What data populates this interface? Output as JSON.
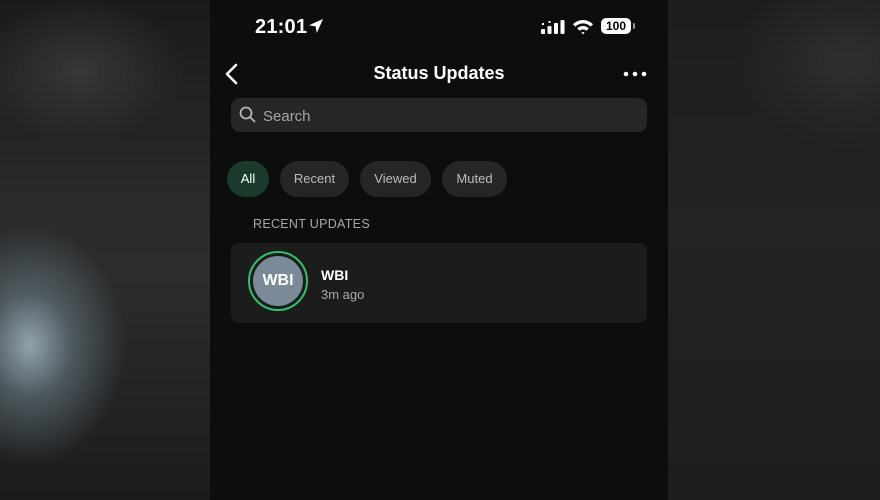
{
  "status_bar": {
    "time": "21:01",
    "battery": "100"
  },
  "nav": {
    "title": "Status Updates"
  },
  "search": {
    "placeholder": "Search"
  },
  "filters": [
    {
      "label": "All",
      "active": true
    },
    {
      "label": "Recent",
      "active": false
    },
    {
      "label": "Viewed",
      "active": false
    },
    {
      "label": "Muted",
      "active": false
    }
  ],
  "section": {
    "label": "RECENT UPDATES"
  },
  "updates": [
    {
      "initials": "WBI",
      "name": "WBI",
      "time": "3m ago"
    }
  ],
  "colors": {
    "accent": "#34c06a",
    "active_chip": "#1a3b2c",
    "avatar": "#7a8a99"
  },
  "icons": {
    "back": "chevron-left-icon",
    "more": "more-horizontal-icon",
    "search": "search-icon",
    "location": "location-arrow-icon",
    "signal": "cellular-signal-icon",
    "wifi": "wifi-icon"
  }
}
